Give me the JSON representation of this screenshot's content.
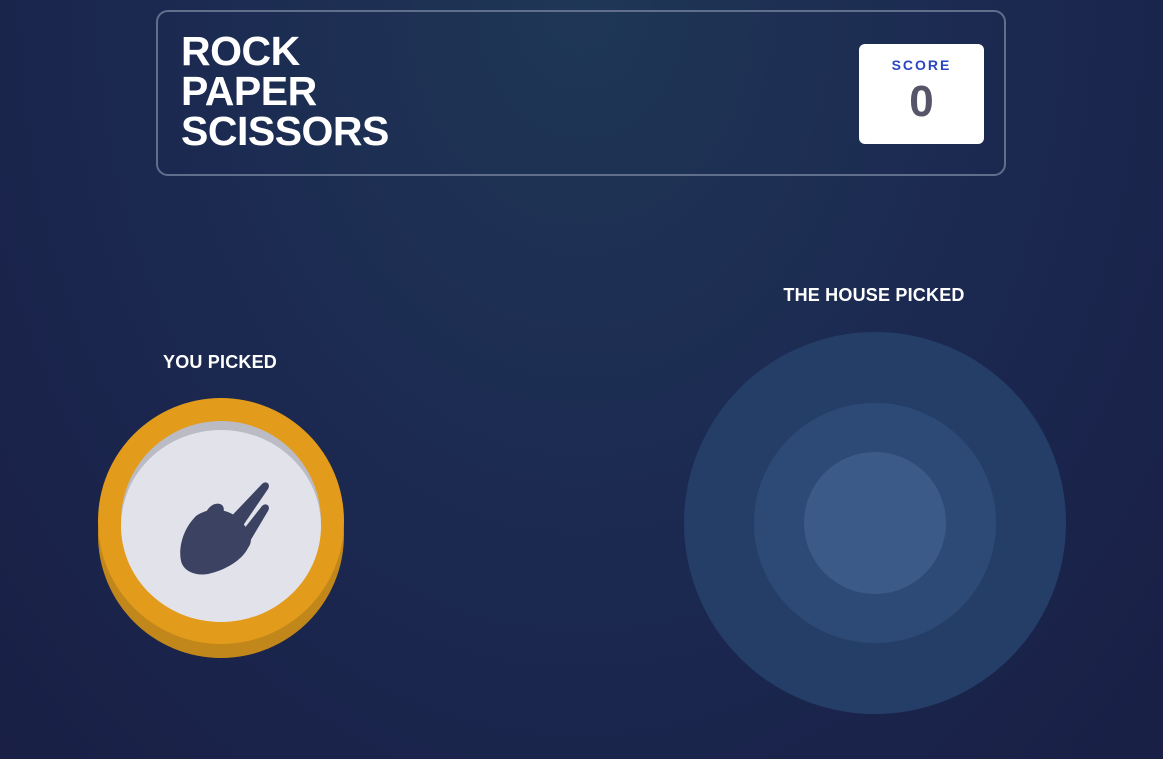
{
  "header": {
    "title_lines": [
      "ROCK",
      "PAPER",
      "SCISSORS"
    ],
    "score_label": "SCORE",
    "score_value": "0"
  },
  "game": {
    "player_label": "YOU PICKED",
    "house_label": "THE HOUSE PICKED",
    "player_choice": {
      "name": "scissors",
      "icon": "scissors-hand-icon",
      "ring_color": "#e39b1b"
    },
    "house_choice": null
  },
  "colors": {
    "background": "#1b2850",
    "header_border": "#5f6f8c",
    "score_label": "#2a46c0",
    "score_value": "#565468",
    "icon": "#3b4262"
  }
}
